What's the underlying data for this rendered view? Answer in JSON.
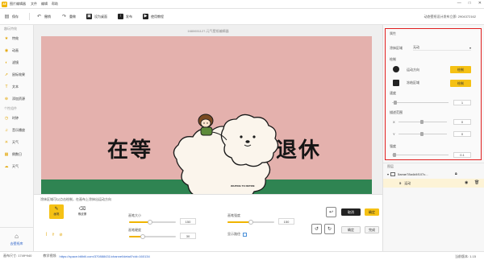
{
  "app": {
    "logo_text": "AE",
    "name": "图片编辑器",
    "menu": [
      "文件",
      "编辑",
      "帮助"
    ],
    "window_controls": [
      "—",
      "□",
      "✕"
    ]
  },
  "toolbar": {
    "buttons": [
      {
        "label": "保存",
        "icon": "save-icon"
      },
      {
        "label": "撤销",
        "icon": "undo-icon"
      },
      {
        "label": "重做",
        "icon": "redo-icon"
      },
      {
        "label": "设为桌面",
        "icon": "wallpaper-icon"
      },
      {
        "label": "发布",
        "icon": "publish-icon"
      },
      {
        "label": "使用教程",
        "icon": "tutorial-icon"
      }
    ],
    "right_text": "动态壁纸设计发布立即: 2904372162"
  },
  "sidebar": {
    "section1": "趣玩特效",
    "items1": [
      {
        "label": "特效",
        "icon": "star-icon"
      },
      {
        "label": "动画",
        "icon": "motion-icon"
      },
      {
        "label": "滤镜",
        "icon": "filter-icon"
      },
      {
        "label": "鼠标效果",
        "icon": "cursor-icon"
      },
      {
        "label": "文本",
        "icon": "text-icon"
      },
      {
        "label": "添加资源",
        "icon": "plus-icon"
      }
    ],
    "section2": "个性组件",
    "items2": [
      {
        "label": "时钟",
        "icon": "clock-icon"
      },
      {
        "label": "音乐播放",
        "icon": "music-icon"
      },
      {
        "label": "天气",
        "icon": "weather-icon"
      },
      {
        "label": "倒数日",
        "icon": "calendar-icon"
      },
      {
        "label": "天气",
        "icon": "cloud-icon"
      }
    ],
    "bottom_label": "去壁纸库"
  },
  "stage": {
    "title": "1680651127-元气壁纸编辑器",
    "text_left": "在等",
    "text_right": "退休",
    "poster_caption": "WAITING TO RETIRE",
    "colors": {
      "bg": "#e4b1ad",
      "grass": "#2f8452"
    }
  },
  "bottom_panel": {
    "hint": "涂抹区域可以点击绘制，在画布上涂抹出运动方向",
    "tools": [
      {
        "label": "画笔",
        "active": true
      },
      {
        "label": "橡皮擦",
        "active": false
      }
    ],
    "brush_size_label": "画笔大小",
    "brush_size_value": "150",
    "brush_size_fraction": 0.45,
    "brush_hardness_label": "画笔硬度",
    "brush_hardness_value": "30",
    "brush_hardness_fraction": 0.3,
    "brush_opacity_label": "画笔强度",
    "brush_opacity_value": "150",
    "brush_opacity_fraction": 0.5,
    "show_path_label": "显示路径",
    "cancel_label": "取消",
    "ok_label": "确定",
    "confirm_label": "确定",
    "done_label": "完成"
  },
  "properties": {
    "title": "属性",
    "mode_label": "涂抹区域",
    "mode_value": "无动",
    "draw_label": "绘制",
    "direction_label": "运动方向",
    "freeze_label": "冻结区域",
    "draw_button": "绘制",
    "speed_label": "速度",
    "speed_value": "1",
    "range_label": "描述范围",
    "x_label": "X",
    "x_value": "0",
    "y_label": "Y",
    "y_value": "0",
    "strength_label": "强度",
    "strength_value": "0.1"
  },
  "layers": {
    "title": "图层",
    "items": [
      {
        "name": "5aeae78a4d4f107c...",
        "selected": false
      },
      {
        "name": "运动",
        "selected": true
      }
    ]
  },
  "statusbar": {
    "size_text": "画布尺寸: 1749*940",
    "tutorial_label": "教学视频:",
    "tutorial_link": "https://space.bilibili.com/370888431/channel/detail?cid=160134",
    "version": "当前版本: 1.15"
  }
}
